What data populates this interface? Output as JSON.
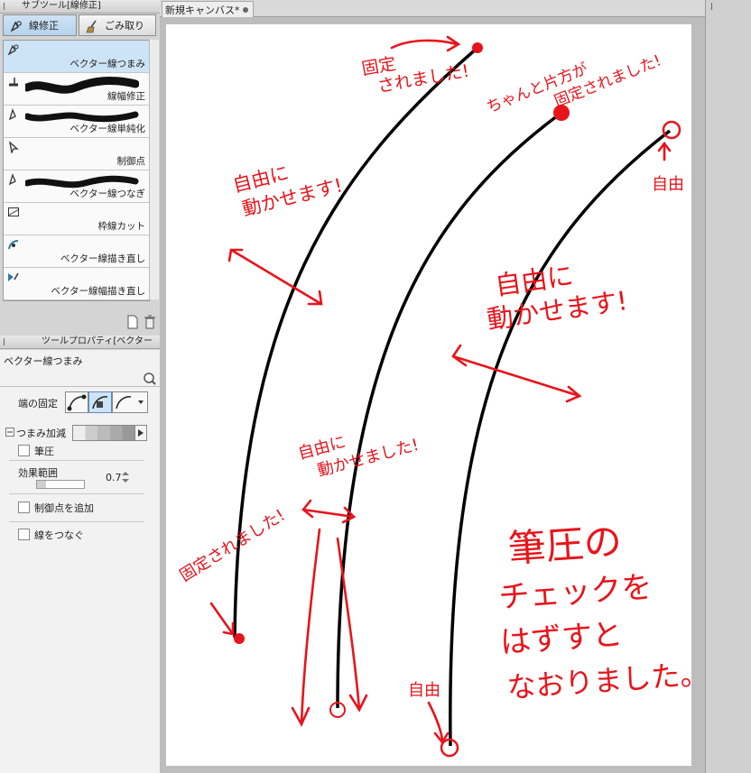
{
  "subtool_panel": {
    "title": "サブツール[線修正]",
    "tabs": [
      {
        "label": "線修正",
        "active": true
      },
      {
        "label": "ごみ取り",
        "active": false
      }
    ],
    "tools": [
      {
        "label": "ベクター線つまみ",
        "icon": "vector-pinch-icon",
        "selected": true
      },
      {
        "label": "線幅修正",
        "icon": "line-width-icon",
        "selected": false
      },
      {
        "label": "ベクター線単純化",
        "icon": "simplify-icon",
        "selected": false
      },
      {
        "label": "制御点",
        "icon": "control-point-icon",
        "selected": false
      },
      {
        "label": "ベクター線つなぎ",
        "icon": "connect-icon",
        "selected": false
      },
      {
        "label": "枠線カット",
        "icon": "frame-cut-icon",
        "selected": false
      },
      {
        "label": "ベクター線描き直し",
        "icon": "redraw-icon",
        "selected": false
      },
      {
        "label": "ベクター線幅描き直し",
        "icon": "redraw-width-icon",
        "selected": false
      }
    ]
  },
  "tool_property": {
    "title": "ツールプロパティ[ベクター",
    "name": "ベクター線つまみ",
    "end_fix_label": "端の固定",
    "pinch_label": "つまみ加減",
    "pressure_label": "筆圧",
    "effect_range_label": "効果範囲",
    "effect_range_value": "0.7",
    "add_control_point_label": "制御点を追加",
    "connect_lines_label": "線をつなぐ"
  },
  "canvas_tab": {
    "title": "新規キャンバス*"
  },
  "annotations": {
    "a1_l1": "固定",
    "a1_l2": "されました!",
    "a2_l1": "ちゃんと片方が",
    "a2_l2": "固定されました!",
    "a3": "自由",
    "a4_l1": "自由に",
    "a4_l2": "動かせます!",
    "a5_l1": "自由に",
    "a5_l2": "動かせます!",
    "a6_l1": "自由に",
    "a6_l2": "動かせました!",
    "a7": "固定されました!",
    "a8": "自由",
    "a9_l1": "筆圧の",
    "a9_l2": "チェックを",
    "a9_l3": "はずすと",
    "a9_l4": "なおりました。"
  },
  "colors": {
    "annotation_red": "#e8141b",
    "selection_blue": "#cde3f6"
  }
}
